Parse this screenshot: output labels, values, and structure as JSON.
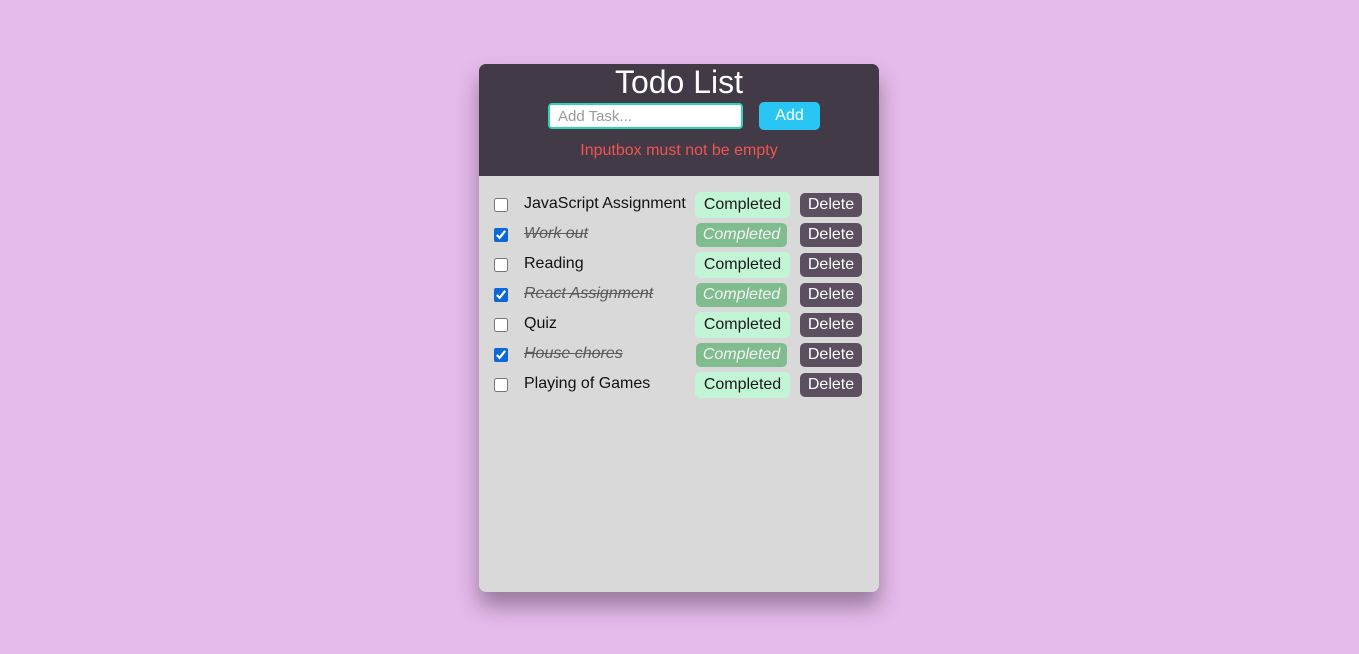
{
  "app": {
    "title": "Todo List",
    "input_placeholder": "Add Task...",
    "input_value": "",
    "add_label": "Add",
    "error_message": "Inputbox must not be empty"
  },
  "tasks": [
    {
      "text": "JavaScript Assignment",
      "done": false,
      "complete_label": "Completed",
      "delete_label": "Delete"
    },
    {
      "text": "Work out",
      "done": true,
      "complete_label": "Completed",
      "delete_label": "Delete"
    },
    {
      "text": "Reading",
      "done": false,
      "complete_label": "Completed",
      "delete_label": "Delete"
    },
    {
      "text": "React Assignment",
      "done": true,
      "complete_label": "Completed",
      "delete_label": "Delete"
    },
    {
      "text": "Quiz",
      "done": false,
      "complete_label": "Completed",
      "delete_label": "Delete"
    },
    {
      "text": "House chores",
      "done": true,
      "complete_label": "Completed",
      "delete_label": "Delete"
    },
    {
      "text": "Playing of Games",
      "done": false,
      "complete_label": "Completed",
      "delete_label": "Delete"
    }
  ],
  "colors": {
    "background": "#e5bbeb",
    "header": "#433a47",
    "card": "#d9d9d9",
    "add_button": "#29c6f4",
    "input_border": "#2ed3b7",
    "error": "#f0544f",
    "completed_button": "#c2f5d6",
    "completed_button_done": "#7fbc8e",
    "delete_button": "#5b4f60"
  }
}
